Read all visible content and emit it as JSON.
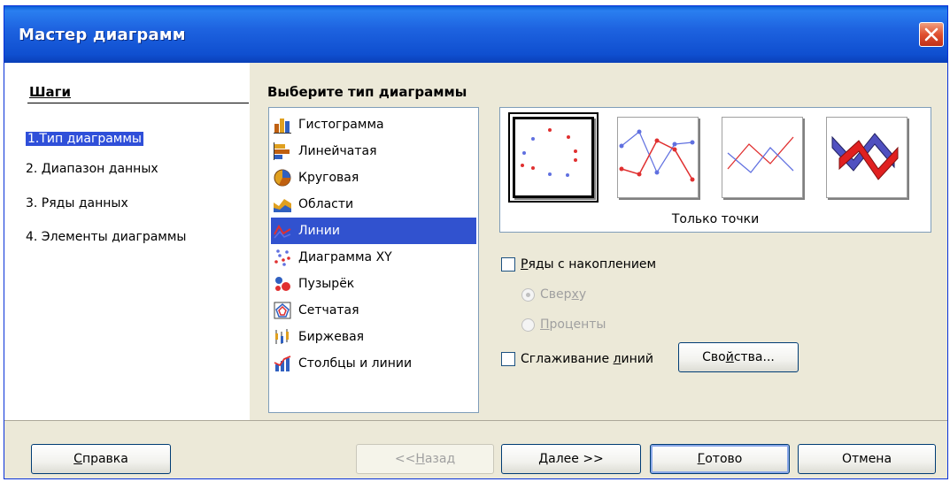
{
  "window": {
    "title": "Мастер диаграмм"
  },
  "steps": {
    "title": "Шаги",
    "items": [
      {
        "label": "1.Тип диаграммы",
        "active": true
      },
      {
        "label": "2. Диапазон данных",
        "active": false
      },
      {
        "label": "3. Ряды данных",
        "active": false
      },
      {
        "label": "4. Элементы диаграммы",
        "active": false
      }
    ]
  },
  "main": {
    "title": "Выберите тип диаграммы",
    "types": [
      {
        "label": "Гистограмма",
        "icon": "column-chart-icon"
      },
      {
        "label": "Линейчатая",
        "icon": "bar-chart-icon"
      },
      {
        "label": "Круговая",
        "icon": "pie-chart-icon"
      },
      {
        "label": "Области",
        "icon": "area-chart-icon"
      },
      {
        "label": "Линии",
        "icon": "line-chart-icon",
        "selected": true
      },
      {
        "label": "Диаграмма XY",
        "icon": "xy-scatter-icon"
      },
      {
        "label": "Пузырёк",
        "icon": "bubble-chart-icon"
      },
      {
        "label": "Сетчатая",
        "icon": "net-chart-icon"
      },
      {
        "label": "Биржевая",
        "icon": "stock-chart-icon"
      },
      {
        "label": "Столбцы и линии",
        "icon": "column-line-chart-icon"
      }
    ],
    "variant_caption": "Только точки",
    "stacked": {
      "label_u": "Р",
      "label_rest": "яды с накоплением",
      "checked": false
    },
    "radio_top": {
      "label_pre": "Свер",
      "label_u": "х",
      "label_post": "у",
      "checked": true
    },
    "radio_percent": {
      "label_u": "П",
      "label_rest": "роценты",
      "checked": false
    },
    "smooth": {
      "label_pre": "Сглаживание ",
      "label_u": "л",
      "label_post": "иний",
      "checked": false
    },
    "properties_btn": {
      "pre": "Сво",
      "u": "й",
      "post": "ства..."
    }
  },
  "buttons": {
    "help": {
      "u": "С",
      "rest": "правка"
    },
    "back": {
      "pre": "<< ",
      "u": "Н",
      "rest": "азад"
    },
    "next": {
      "u": "Д",
      "rest": "алее >>"
    },
    "finish": {
      "u": "Г",
      "rest": "отово"
    },
    "cancel": "Отмена"
  },
  "colors": {
    "selection": "#3152cf",
    "titlebar": "#1e63e0",
    "close": "#e05030"
  }
}
